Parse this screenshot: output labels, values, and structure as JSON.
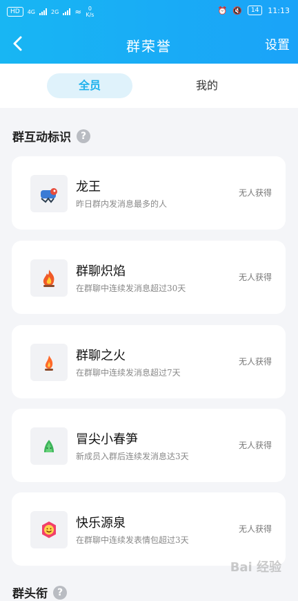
{
  "status_bar": {
    "left_text": "0\nK/s",
    "speed": "0",
    "speed_unit": "K/s",
    "battery": "14",
    "time": "11:13",
    "sim1": "HD",
    "net1": "4G",
    "net2": "2G"
  },
  "header": {
    "title": "群荣誉",
    "settings_label": "设置"
  },
  "tabs": [
    {
      "label": "全员",
      "active": true
    },
    {
      "label": "我的",
      "active": false
    }
  ],
  "section": {
    "title": "群互动标识",
    "next_title": "群头衔"
  },
  "badges": [
    {
      "name": "龙王",
      "desc": "昨日群内发消息最多的人",
      "status": "无人获得",
      "icon": "dragon-icon"
    },
    {
      "name": "群聊炽焰",
      "desc": "在群聊中连续发消息超过30天",
      "status": "无人获得",
      "icon": "blazing-fire-icon"
    },
    {
      "name": "群聊之火",
      "desc": "在群聊中连续发消息超过7天",
      "status": "无人获得",
      "icon": "fire-icon"
    },
    {
      "name": "冒尖小春笋",
      "desc": "新成员入群后连续发消息达3天",
      "status": "无人获得",
      "icon": "bamboo-shoot-icon"
    },
    {
      "name": "快乐源泉",
      "desc": "在群聊中连续发表情包超过3天",
      "status": "无人获得",
      "icon": "happy-face-icon"
    }
  ],
  "watermark": "Bai 经验",
  "colors": {
    "header": "#1aa8f5",
    "accent": "#1db1ec"
  }
}
